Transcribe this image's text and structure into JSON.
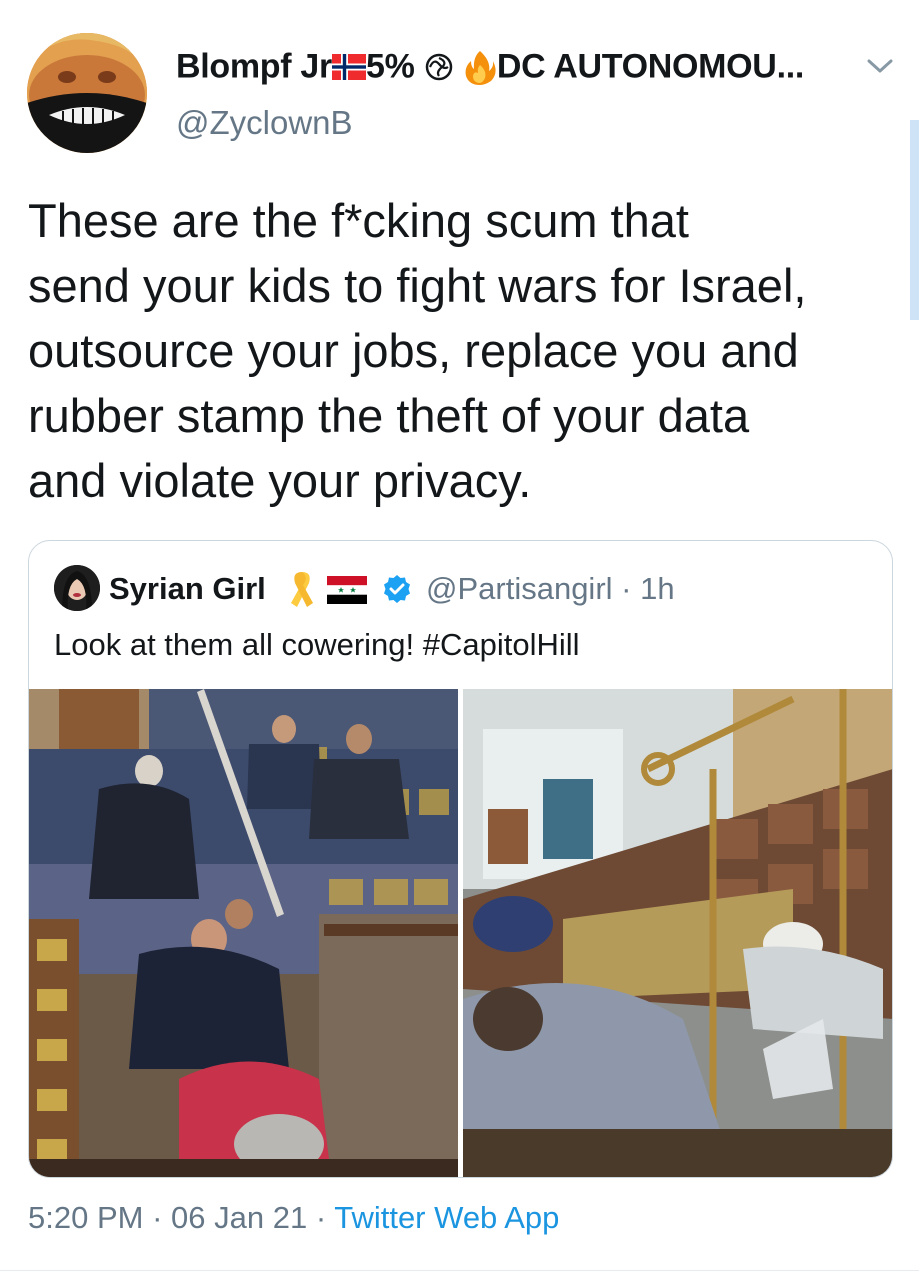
{
  "tweet": {
    "author": {
      "display_name": "Blompf Jr",
      "display_suffix": "5%",
      "display_tail": "DC AUTONOMOU...",
      "handle": "@ZyclownB",
      "avatar_icon": "masked-face-avatar",
      "flag_icon": "norway-flag-icon",
      "symbol_icon": "spiral-symbol-icon",
      "fire_icon": "fire-emoji-icon"
    },
    "menu_icon": "chevron-down-icon",
    "text": "These are the f*cking scum that\nsend your kids to fight wars for Israel,\noutsource your jobs, replace you and\nrubber stamp the theft of your data\nand violate your privacy.",
    "timestamp": "5:20 PM",
    "date": "06 Jan 21",
    "separator": "·",
    "source": "Twitter Web App"
  },
  "quoted_tweet": {
    "display_name": "Syrian Girl",
    "handle": "@Partisangirl",
    "time_ago": "1h",
    "separator": "·",
    "text": "Look at them all cowering! #CapitolHill",
    "ribbon_icon": "yellow-ribbon-icon",
    "flag_icon": "syria-flag-icon",
    "verified_icon": "verified-badge-icon",
    "images": [
      {
        "subject": "people-crouching-in-chamber-photo"
      },
      {
        "subject": "people-lying-between-seats-photo"
      }
    ]
  },
  "colors": {
    "primary_text": "#14171a",
    "secondary_text": "#657786",
    "link_blue": "#1b95e0",
    "border": "#ccd6dd"
  }
}
